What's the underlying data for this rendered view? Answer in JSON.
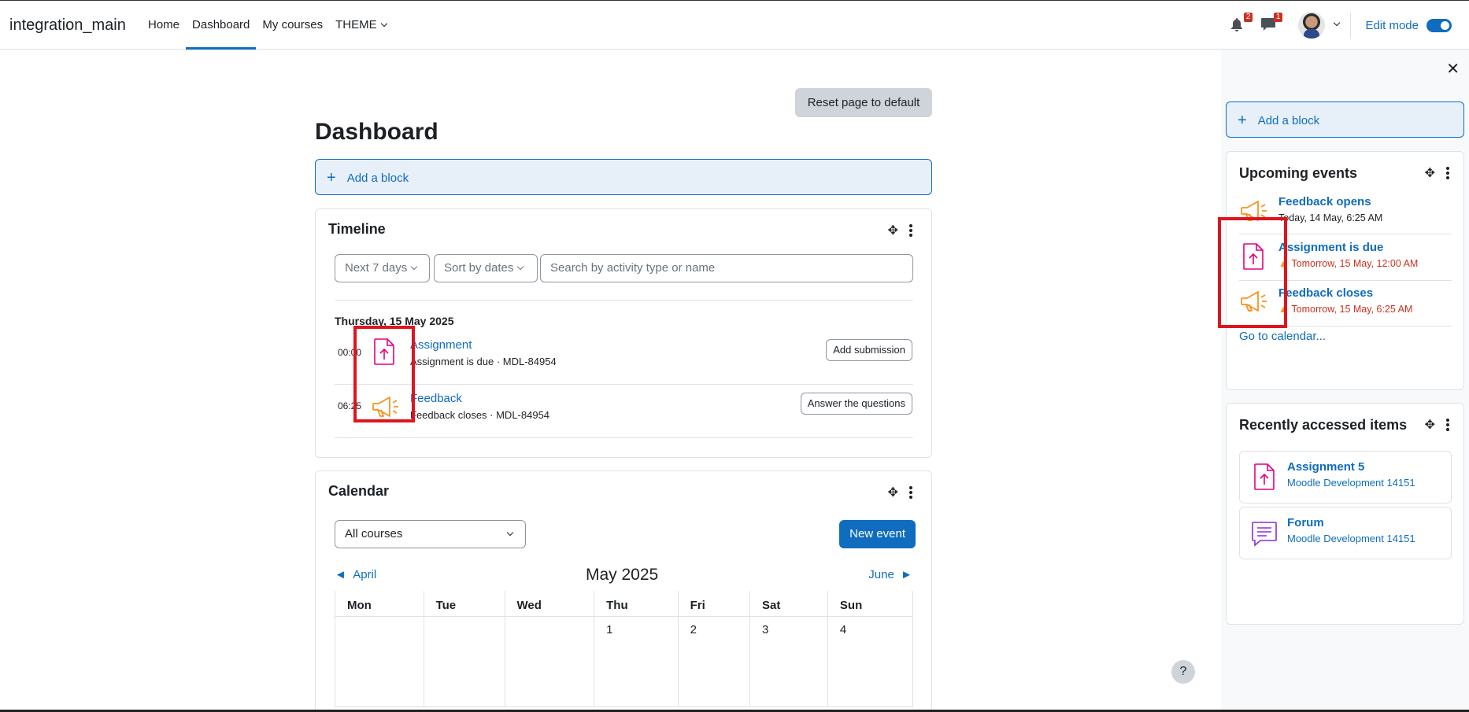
{
  "site_name": "integration_main",
  "nav": {
    "home": "Home",
    "dashboard": "Dashboard",
    "my_courses": "My courses",
    "theme": "THEME"
  },
  "notifications_count": "2",
  "messages_count": "1",
  "edit_mode_label": "Edit mode",
  "main": {
    "reset_button": "Reset page to default",
    "page_title": "Dashboard",
    "add_block": "Add a block"
  },
  "timeline": {
    "title": "Timeline",
    "filter_range": "Next 7 days",
    "sort": "Sort by dates",
    "search_placeholder": "Search by activity type or name",
    "date_heading": "Thursday, 15 May 2025",
    "events": [
      {
        "time": "00:00",
        "title": "Assignment",
        "subtitle": "Assignment is due · MDL-84954",
        "action": "Add submission",
        "icon": "assignment-upload-icon"
      },
      {
        "time": "06:25",
        "title": "Feedback",
        "subtitle": "Feedback closes · MDL-84954",
        "action": "Answer the questions",
        "icon": "feedback-megaphone-icon"
      }
    ]
  },
  "calendar": {
    "title": "Calendar",
    "course_filter": "All courses",
    "new_event": "New event",
    "prev_month": "April",
    "current_month": "May 2025",
    "next_month": "June",
    "weekdays": [
      "Mon",
      "Tue",
      "Wed",
      "Thu",
      "Fri",
      "Sat",
      "Sun"
    ],
    "first_row": [
      "",
      "",
      "",
      "1",
      "2",
      "3",
      "4"
    ]
  },
  "drawer": {
    "add_block": "Add a block",
    "upcoming": {
      "title": "Upcoming events",
      "items": [
        {
          "title": "Feedback opens",
          "date": "Today, 14 May, 6:25 AM",
          "warn": false
        },
        {
          "title": "Assignment is due",
          "date": "Tomorrow, 15 May, 12:00 AM",
          "warn": true
        },
        {
          "title": "Feedback closes",
          "date": "Tomorrow, 15 May, 6:25 AM",
          "warn": true
        }
      ],
      "go_to_calendar": "Go to calendar..."
    },
    "recent": {
      "title": "Recently accessed items",
      "items": [
        {
          "title": "Assignment 5",
          "course": "Moodle Development 14151"
        },
        {
          "title": "Forum",
          "course": "Moodle Development 14151"
        }
      ]
    }
  },
  "help_label": "?",
  "colors": {
    "primary": "#0f6cbf",
    "assignment": "#e6007e",
    "feedback": "#f7931e",
    "forum": "#8a2be2",
    "highlight": "#e0141e"
  }
}
